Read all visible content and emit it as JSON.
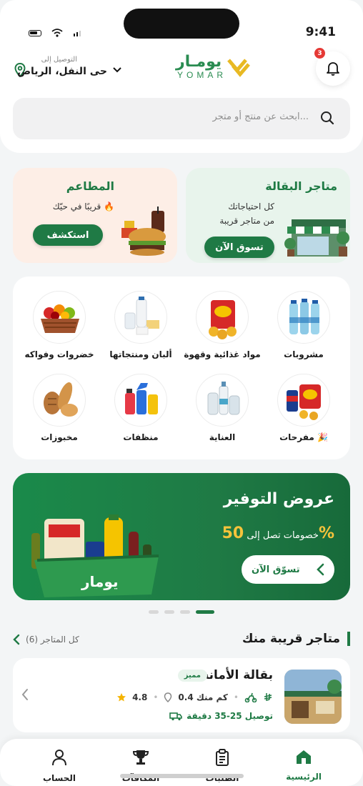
{
  "status_bar": {
    "time": "9:41"
  },
  "header": {
    "delivery_label": "التوصيل إلى",
    "delivery_value": "حى النفل، الرياض",
    "logo_ar": "يومـار",
    "logo_en": "YOMAR",
    "notification_count": "3"
  },
  "search": {
    "placeholder": "ابحث عن منتج أو متجر..."
  },
  "promos": {
    "grocery": {
      "title": "متاجر البقالة",
      "line1": "كل احتياجاتك",
      "line2": "من متاجر قريبة",
      "button": "تسوق الآن"
    },
    "restaurants": {
      "title": "المطاعم",
      "subtitle": "قريبًا في حيّك 🔥",
      "button": "استكشف"
    }
  },
  "categories": [
    {
      "label": "مشروبات"
    },
    {
      "label": "مواد غذائية وقهوة"
    },
    {
      "label": "ألبان ومنتجاتها"
    },
    {
      "label": "خضروات وفواكه"
    },
    {
      "label": "مفرحات 🎉"
    },
    {
      "label": "العناية"
    },
    {
      "label": "منظفات"
    },
    {
      "label": "مخبوزات"
    }
  ],
  "banner": {
    "title": "عروض التوفير",
    "subtitle_prefix": "خصومات تصل إلى",
    "percent": "50%",
    "button": "تسوّق الآن",
    "basket_brand": "يومار"
  },
  "nearby": {
    "title": "متاجر قريبة منك",
    "see_all": "كل المتاجر (6)",
    "store": {
      "name": "بقالة الأمانة",
      "badge": "مميز",
      "rating": "4.8",
      "distance": "0.4 كم منك",
      "delivery": "توصيل 25-35 دقيقة"
    }
  },
  "nav": {
    "home": "الرئيسية",
    "orders": "الطلبات",
    "rewards": "المكافآت",
    "account": "الحساب"
  },
  "colors": {
    "brand_green": "#1f7a45",
    "accent_yellow": "#f5c33b",
    "badge_red": "#e53935"
  }
}
